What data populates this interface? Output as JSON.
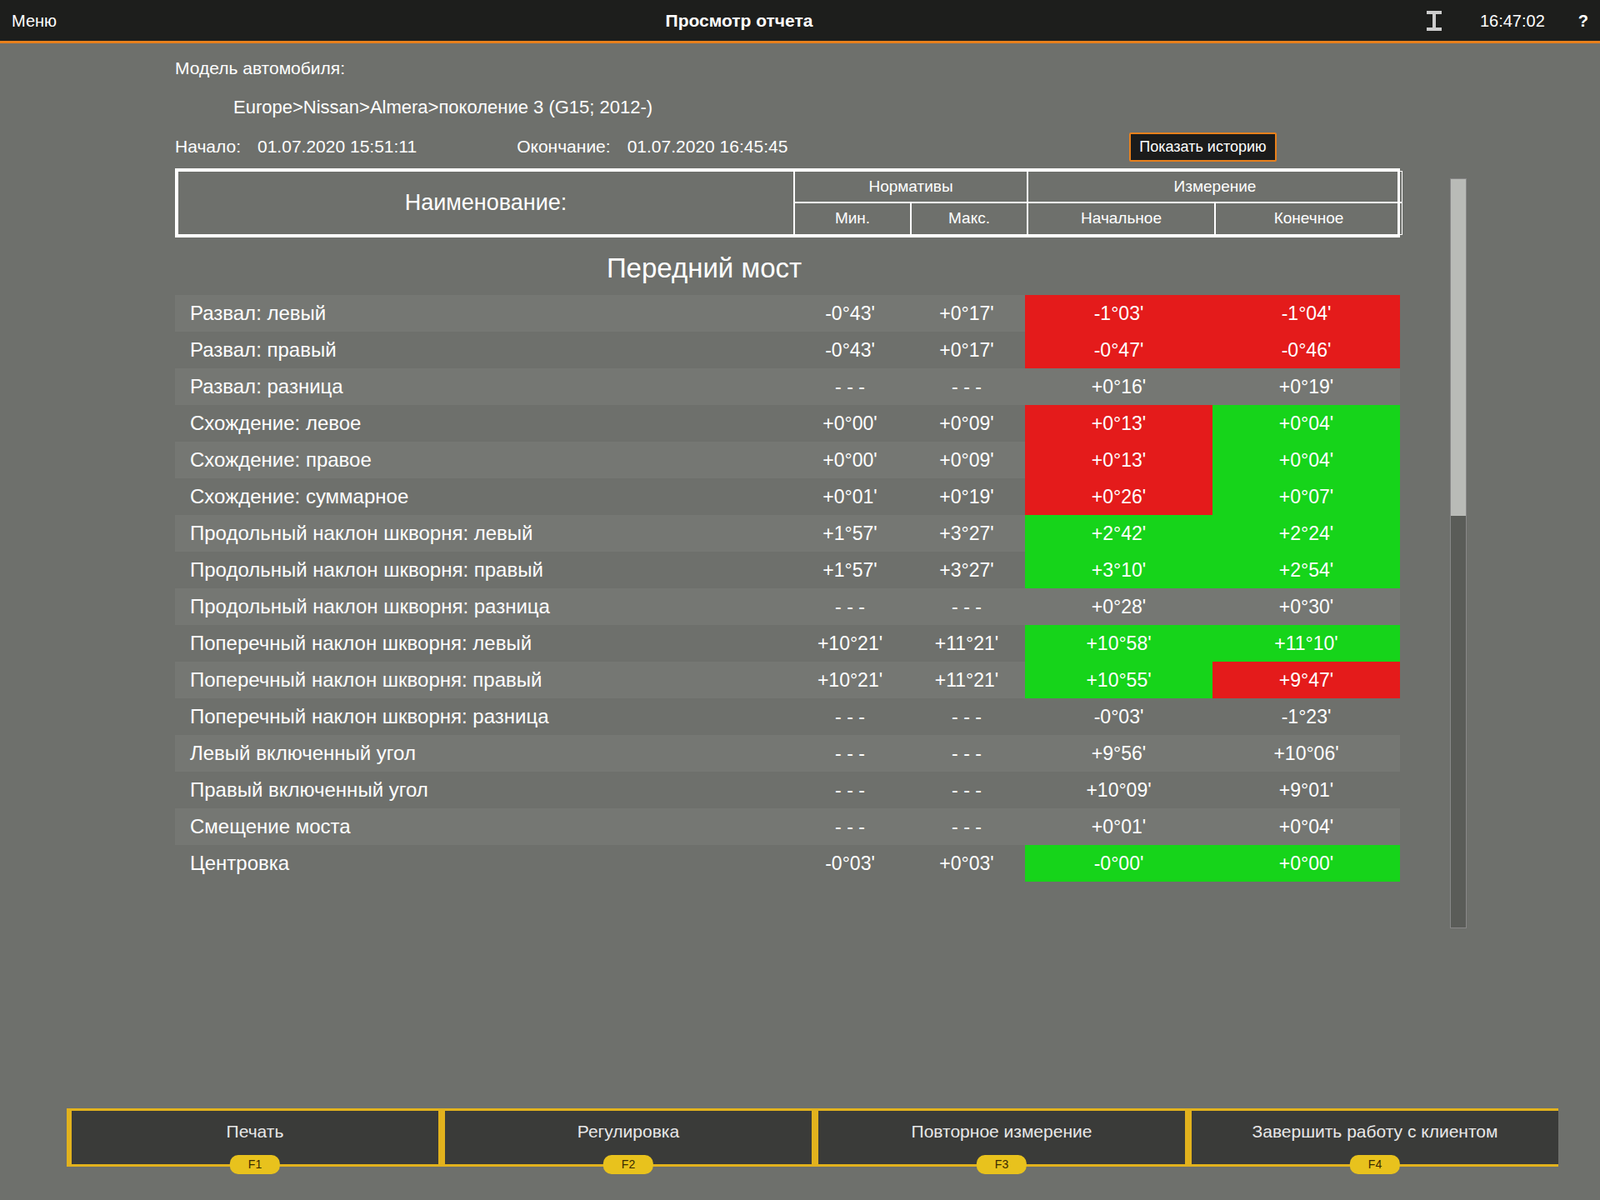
{
  "top_bar": {
    "menu": "Меню",
    "title": "Просмотр отчета",
    "time": "16:47:02",
    "help": "?"
  },
  "vehicle": {
    "label": "Модель автомобиля:",
    "path": "Europe>Nissan>Almera>поколение 3 (G15; 2012-)"
  },
  "session": {
    "start_label": "Начало:",
    "start": "01.07.2020 15:51:11",
    "end_label": "Окончание:",
    "end": "01.07.2020 16:45:45"
  },
  "history_button": "Показать историю",
  "table": {
    "name_header": "Наименование:",
    "norms_header": "Нормативы",
    "min_header": "Мин.",
    "max_header": "Макс.",
    "measure_header": "Измерение",
    "initial_header": "Начальное",
    "final_header": "Конечное",
    "section": "Передний мост",
    "rows": [
      {
        "name": "Развал: левый",
        "min": "-0°43'",
        "max": "+0°17'",
        "initial": {
          "value": "-1°03'",
          "status": "out"
        },
        "final": {
          "value": "-1°04'",
          "status": "out"
        }
      },
      {
        "name": "Развал: правый",
        "min": "-0°43'",
        "max": "+0°17'",
        "initial": {
          "value": "-0°47'",
          "status": "out"
        },
        "final": {
          "value": "-0°46'",
          "status": "out"
        }
      },
      {
        "name": "Развал: разница",
        "min": "- - -",
        "max": "- - -",
        "initial": {
          "value": "+0°16'",
          "status": "none"
        },
        "final": {
          "value": "+0°19'",
          "status": "none"
        }
      },
      {
        "name": "Схождение: левое",
        "min": "+0°00'",
        "max": "+0°09'",
        "initial": {
          "value": "+0°13'",
          "status": "out"
        },
        "final": {
          "value": "+0°04'",
          "status": "in"
        }
      },
      {
        "name": "Схождение: правое",
        "min": "+0°00'",
        "max": "+0°09'",
        "initial": {
          "value": "+0°13'",
          "status": "out"
        },
        "final": {
          "value": "+0°04'",
          "status": "in"
        }
      },
      {
        "name": "Схождение: суммарное",
        "min": "+0°01'",
        "max": "+0°19'",
        "initial": {
          "value": "+0°26'",
          "status": "out"
        },
        "final": {
          "value": "+0°07'",
          "status": "in"
        }
      },
      {
        "name": "Продольный наклон шкворня: левый",
        "min": "+1°57'",
        "max": "+3°27'",
        "initial": {
          "value": "+2°42'",
          "status": "in"
        },
        "final": {
          "value": "+2°24'",
          "status": "in"
        }
      },
      {
        "name": "Продольный наклон шкворня: правый",
        "min": "+1°57'",
        "max": "+3°27'",
        "initial": {
          "value": "+3°10'",
          "status": "in"
        },
        "final": {
          "value": "+2°54'",
          "status": "in"
        }
      },
      {
        "name": "Продольный наклон шкворня: разница",
        "min": "- - -",
        "max": "- - -",
        "initial": {
          "value": "+0°28'",
          "status": "none"
        },
        "final": {
          "value": "+0°30'",
          "status": "none"
        }
      },
      {
        "name": "Поперечный наклон шкворня: левый",
        "min": "+10°21'",
        "max": "+11°21'",
        "initial": {
          "value": "+10°58'",
          "status": "in"
        },
        "final": {
          "value": "+11°10'",
          "status": "in"
        }
      },
      {
        "name": "Поперечный наклон шкворня: правый",
        "min": "+10°21'",
        "max": "+11°21'",
        "initial": {
          "value": "+10°55'",
          "status": "in"
        },
        "final": {
          "value": "+9°47'",
          "status": "out"
        }
      },
      {
        "name": "Поперечный наклон шкворня: разница",
        "min": "- - -",
        "max": "- - -",
        "initial": {
          "value": "-0°03'",
          "status": "none"
        },
        "final": {
          "value": "-1°23'",
          "status": "none"
        }
      },
      {
        "name": "Левый включенный угол",
        "min": "- - -",
        "max": "- - -",
        "initial": {
          "value": "+9°56'",
          "status": "none"
        },
        "final": {
          "value": "+10°06'",
          "status": "none"
        }
      },
      {
        "name": "Правый включенный угол",
        "min": "- - -",
        "max": "- - -",
        "initial": {
          "value": "+10°09'",
          "status": "none"
        },
        "final": {
          "value": "+9°01'",
          "status": "none"
        }
      },
      {
        "name": "Смещение моста",
        "min": "- - -",
        "max": "- - -",
        "initial": {
          "value": "+0°01'",
          "status": "none"
        },
        "final": {
          "value": "+0°04'",
          "status": "none"
        }
      },
      {
        "name": "Центровка",
        "min": "-0°03'",
        "max": "+0°03'",
        "initial": {
          "value": "-0°00'",
          "status": "in"
        },
        "final": {
          "value": "+0°00'",
          "status": "in"
        }
      }
    ]
  },
  "scrollbar": {
    "level": 0.45
  },
  "footer": {
    "buttons": [
      {
        "label": "Печать",
        "key": "F1"
      },
      {
        "label": "Регулировка",
        "key": "F2"
      },
      {
        "label": "Повторное измерение",
        "key": "F3"
      },
      {
        "label": "Завершить работу с клиентом",
        "key": "F4"
      }
    ]
  }
}
